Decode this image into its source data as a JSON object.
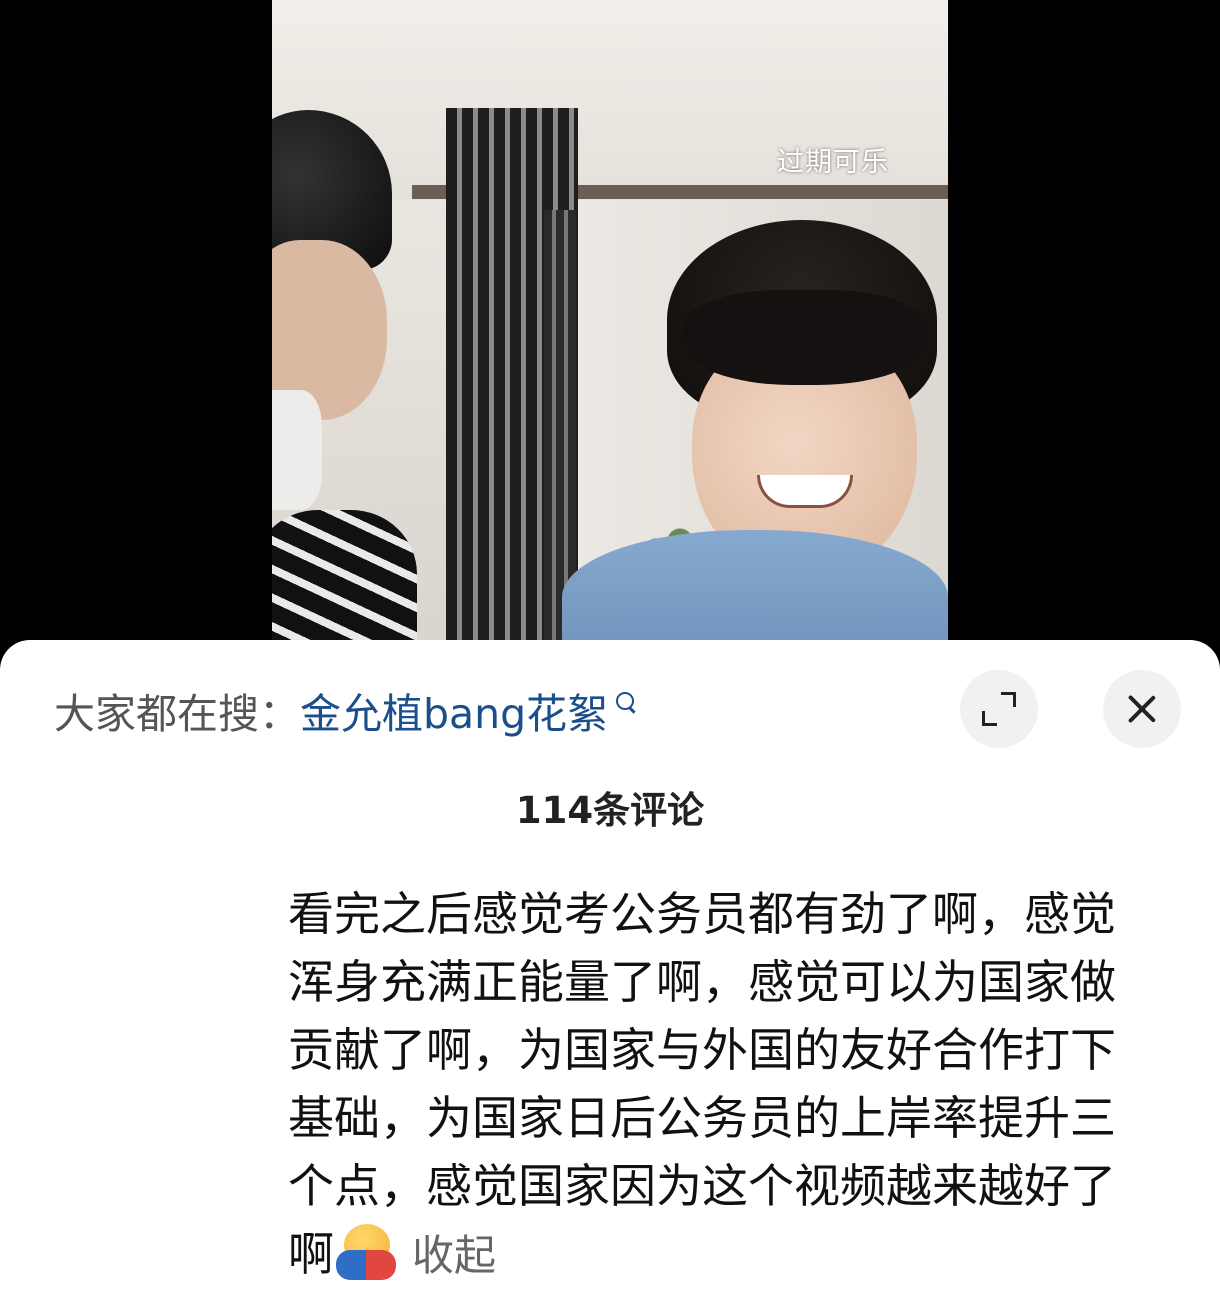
{
  "video": {
    "watermark": "过期可乐"
  },
  "sheet": {
    "search": {
      "prefix": "大家都在搜：",
      "term": "金允植bang花絮",
      "icon": "search-icon"
    },
    "expand_button": {
      "icon": "expand-icon"
    },
    "close_button": {
      "icon": "close-icon"
    },
    "comment_count": "114条评论",
    "comment": {
      "lines": [
        "看完之后感觉考公务员都有劲了啊，感觉",
        "浑身充满正能量了啊，感觉可以为国家做",
        "贡献了啊，为国家与外国的友好合作打下",
        "基础，为国家日后公务员的上岸率提升三",
        "个点，感觉国家因为这个视频越来越好了",
        "啊"
      ],
      "emoji": "hugging-face-emoji",
      "collapse_label": "收起"
    }
  },
  "colors": {
    "link": "#1b4f8c",
    "sheet_bg": "#ffffff",
    "page_bg": "#000000"
  }
}
